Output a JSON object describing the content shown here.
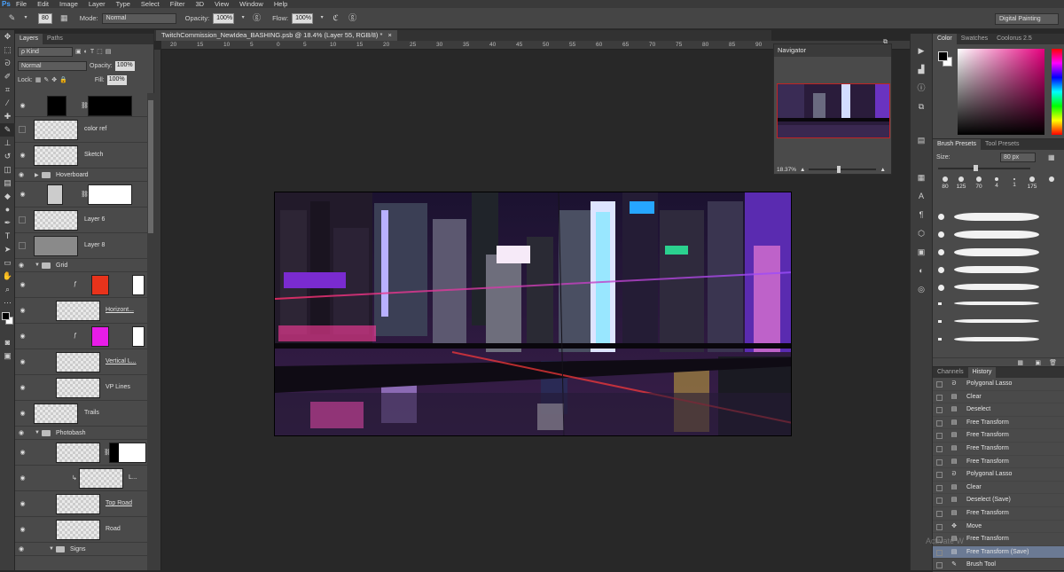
{
  "menubar": {
    "logo": "Ps",
    "items": [
      "File",
      "Edit",
      "Image",
      "Layer",
      "Type",
      "Select",
      "Filter",
      "3D",
      "View",
      "Window",
      "Help"
    ]
  },
  "options": {
    "size": "80",
    "mode_label": "Mode:",
    "mode_value": "Normal",
    "opacity_label": "Opacity:",
    "opacity_value": "100%",
    "flow_label": "Flow:",
    "flow_value": "100%",
    "workspace": "Digital Painting"
  },
  "layers_panel": {
    "tabs": [
      "Layers",
      "Paths"
    ],
    "filter": "ρ Kind",
    "blend_mode": "Normal",
    "opacity_label": "Opacity:",
    "opacity_value": "100%",
    "lock_label": "Lock:",
    "fill_label": "Fill:",
    "fill_value": "100%",
    "rows": {
      "color_ref": "color ref",
      "sketch": "Sketch",
      "hoverboard": "Hoverboard",
      "layer6": "Layer 6",
      "layer8": "Layer 8",
      "grid": "Grid",
      "horizont": "Horizont...",
      "vertical": "Vertical L...",
      "vp_lines": "VP Lines",
      "trails": "Trails",
      "photobash": "Photobash",
      "l_layer": "L...",
      "top_road": "Top Road",
      "road": "Road",
      "signs": "Signs"
    }
  },
  "document": {
    "tab_title": "TwitchCommission_NewIdea_BASHING.psb @ 18.4% (Layer 55, RGB/8) *",
    "ruler_ticks": [
      "20",
      "15",
      "10",
      "5",
      "0",
      "5",
      "10",
      "15",
      "20",
      "25",
      "30",
      "35",
      "40",
      "45",
      "50",
      "55",
      "60",
      "65",
      "70",
      "75",
      "80",
      "85",
      "90"
    ]
  },
  "navigator": {
    "title": "Navigator",
    "zoom": "18.37%"
  },
  "color_panel": {
    "tabs": [
      "Color",
      "Swatches",
      "Coolorus 2.5"
    ],
    "foreground": "#000000",
    "background": "#ffffff"
  },
  "brush_panel": {
    "tabs": [
      "Brush Presets",
      "Tool Presets"
    ],
    "size_label": "Size:",
    "size_value": "80 px",
    "tip_sizes": [
      "80",
      "125",
      "70",
      "4",
      "1",
      "175"
    ]
  },
  "history_panel": {
    "tabs": [
      "Channels",
      "History"
    ],
    "items": [
      "Polygonal Lasso",
      "Clear",
      "Deselect",
      "Free Transform",
      "Free Transform",
      "Free Transform",
      "Free Transform",
      "Polygonal Lasso",
      "Clear",
      "Deselect (Save)",
      "Free Transform",
      "Move",
      "Free Transform",
      "Free Transform (Save)",
      "Brush Tool"
    ],
    "selected_index": 13
  },
  "watermark": "Activate W"
}
